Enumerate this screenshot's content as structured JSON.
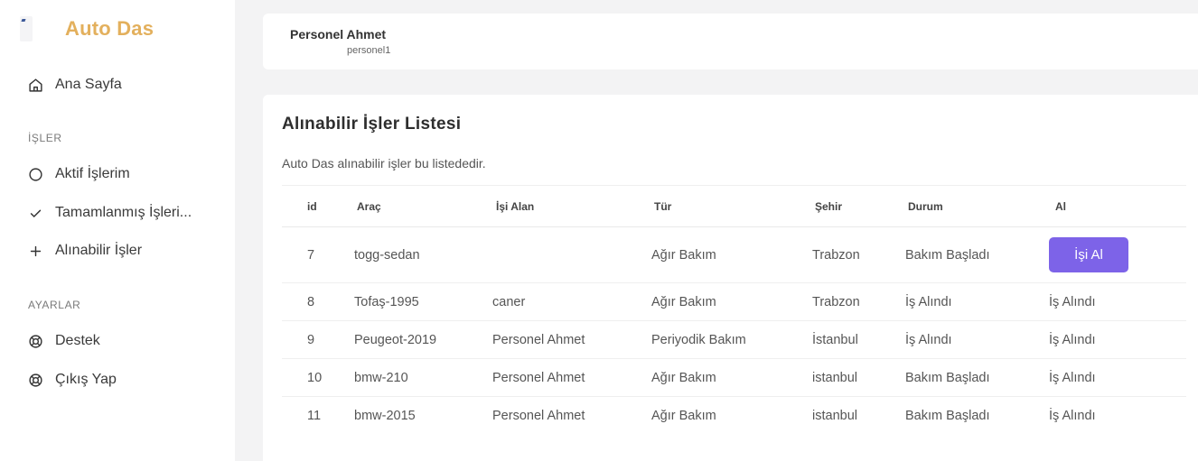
{
  "brand": {
    "name": "Auto Das"
  },
  "sidebar": {
    "home": {
      "label": "Ana Sayfa",
      "icon": "home-icon"
    },
    "sections": [
      {
        "label": "İŞLER",
        "items": [
          {
            "label": "Aktif İşlerim",
            "icon": "circle-icon"
          },
          {
            "label": "Tamamlanmış İşleri...",
            "icon": "check-icon"
          },
          {
            "label": "Alınabilir İşler",
            "icon": "plus-icon"
          }
        ]
      },
      {
        "label": "AYARLAR",
        "items": [
          {
            "label": "Destek",
            "icon": "lifebuoy-icon"
          },
          {
            "label": "Çıkış Yap",
            "icon": "lifebuoy-icon"
          }
        ]
      }
    ]
  },
  "user": {
    "name": "Personel Ahmet",
    "handle": "personel1"
  },
  "main": {
    "title": "Alınabilir İşler Listesi",
    "description": "Auto Das alınabilir işler bu listededir.",
    "table": {
      "headers": [
        "id",
        "Araç",
        "İşi Alan",
        "Tür",
        "Şehir",
        "Durum",
        "Al"
      ],
      "rows": [
        [
          "7",
          "togg-sedan",
          "",
          "Ağır Bakım",
          "Trabzon",
          "Bakım Başladı",
          "İşi Al"
        ],
        [
          "8",
          "Tofaş-1995",
          "caner",
          "Ağır Bakım",
          "Trabzon",
          "İş Alındı",
          "İş Alındı"
        ],
        [
          "9",
          "Peugeot-2019",
          "Personel Ahmet",
          "Periyodik Bakım",
          "İstanbul",
          "İş Alındı",
          "İş Alındı"
        ],
        [
          "10",
          "bmw-210",
          "Personel Ahmet",
          "Ağır Bakım",
          "istanbul",
          "Bakım Başladı",
          "İş Alındı"
        ],
        [
          "11",
          "bmw-2015",
          "Personel Ahmet",
          "Ağır Bakım",
          "istanbul",
          "Bakım Başladı",
          "İş Alındı"
        ]
      ]
    }
  },
  "colors": {
    "brand": "#e3b05d",
    "accent": "#7d63e8"
  }
}
